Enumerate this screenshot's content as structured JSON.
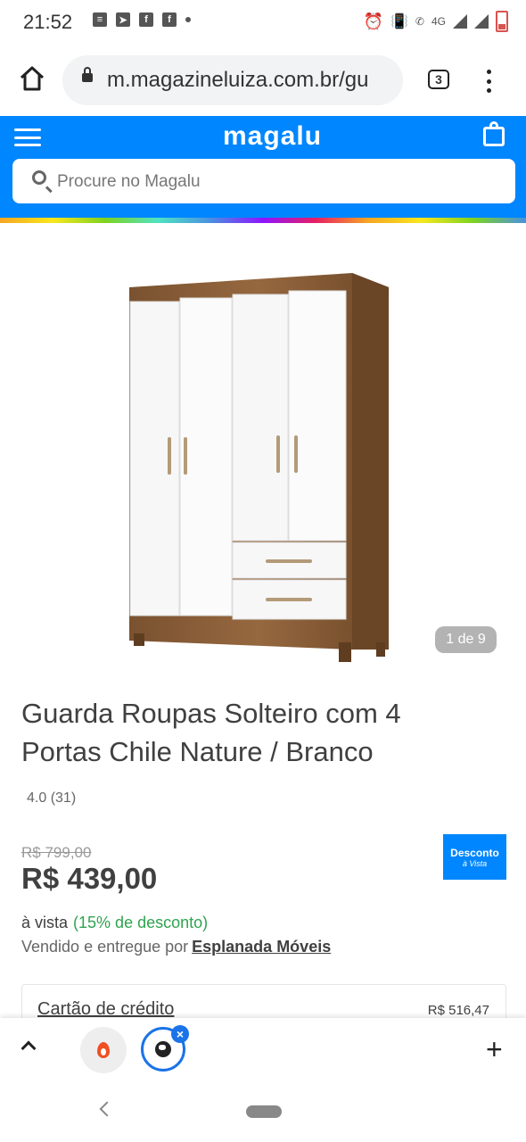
{
  "status_bar": {
    "time": "21:52",
    "icons": [
      "message-icon",
      "telegram-icon",
      "facebook-icon",
      "facebook-icon",
      "dot-icon",
      "alarm-icon",
      "vibrate-icon",
      "call-4g-icon",
      "4g-signal-icon",
      "signal-icon",
      "battery-low-icon"
    ],
    "network": "4G"
  },
  "browser": {
    "url": "m.magazineluiza.com.br/gu",
    "tab_count": "3"
  },
  "site": {
    "logo": "magalu",
    "search_placeholder": "Procure no Magalu",
    "brand_color": "#0086ff"
  },
  "gallery": {
    "counter": "1 de 9"
  },
  "product": {
    "title": "Guarda Roupas Solteiro com 4 Portas Chile Nature / Branco",
    "rating": "4.0 (31)",
    "old_price": "R$ 799,00",
    "price": "R$ 439,00",
    "badge_line1": "Desconto",
    "badge_line2": "à Vista",
    "payment_label": "à vista",
    "discount_text": "(15% de desconto)",
    "seller_prefix": "Vendido e entregue por",
    "seller_name": "Esplanada Móveis"
  },
  "payment_option": {
    "label": "Cartão de crédito",
    "value": "R$ 516,47"
  },
  "bottom_bar": {
    "close_symbol": "×",
    "plus_symbol": "+"
  }
}
